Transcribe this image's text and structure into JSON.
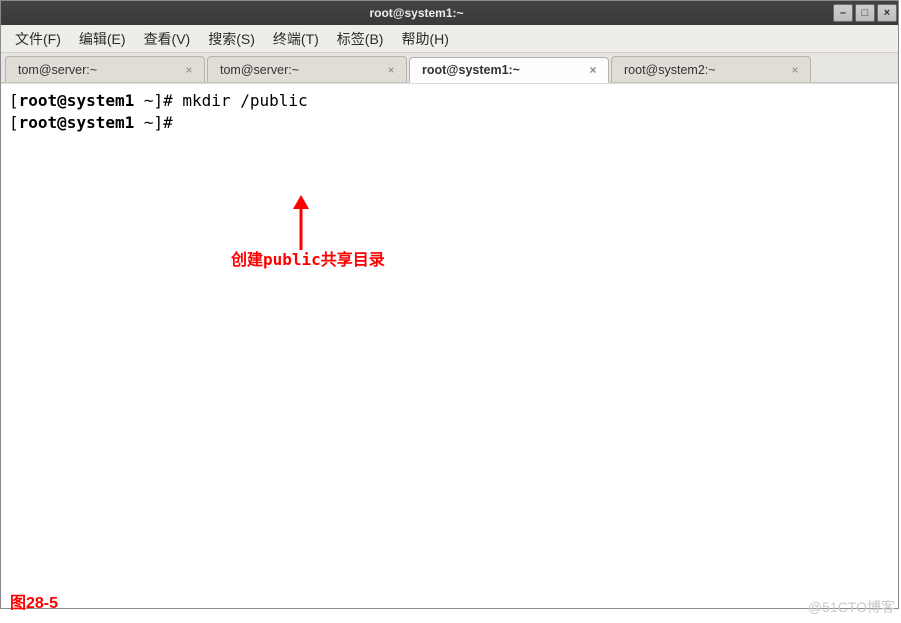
{
  "window": {
    "title": "root@system1:~"
  },
  "menu": {
    "file": "文件(F)",
    "edit": "编辑(E)",
    "view": "查看(V)",
    "search": "搜索(S)",
    "terminal": "终端(T)",
    "tabs": "标签(B)",
    "help": "帮助(H)"
  },
  "tabs": [
    {
      "label": "tom@server:~"
    },
    {
      "label": "tom@server:~"
    },
    {
      "label": "root@system1:~",
      "active": true
    },
    {
      "label": "root@system2:~"
    }
  ],
  "terminal_lines": [
    {
      "prompt_open": "[",
      "prompt_user": "root@system1",
      "prompt_path": " ~]#",
      "cmd": " mkdir /public"
    },
    {
      "prompt_open": "[",
      "prompt_user": "root@system1",
      "prompt_path": " ~]#",
      "cmd": " "
    }
  ],
  "annotation": {
    "text": "创建public共享目录"
  },
  "figure_caption": "图28-5",
  "watermark": "@51CTO博客"
}
